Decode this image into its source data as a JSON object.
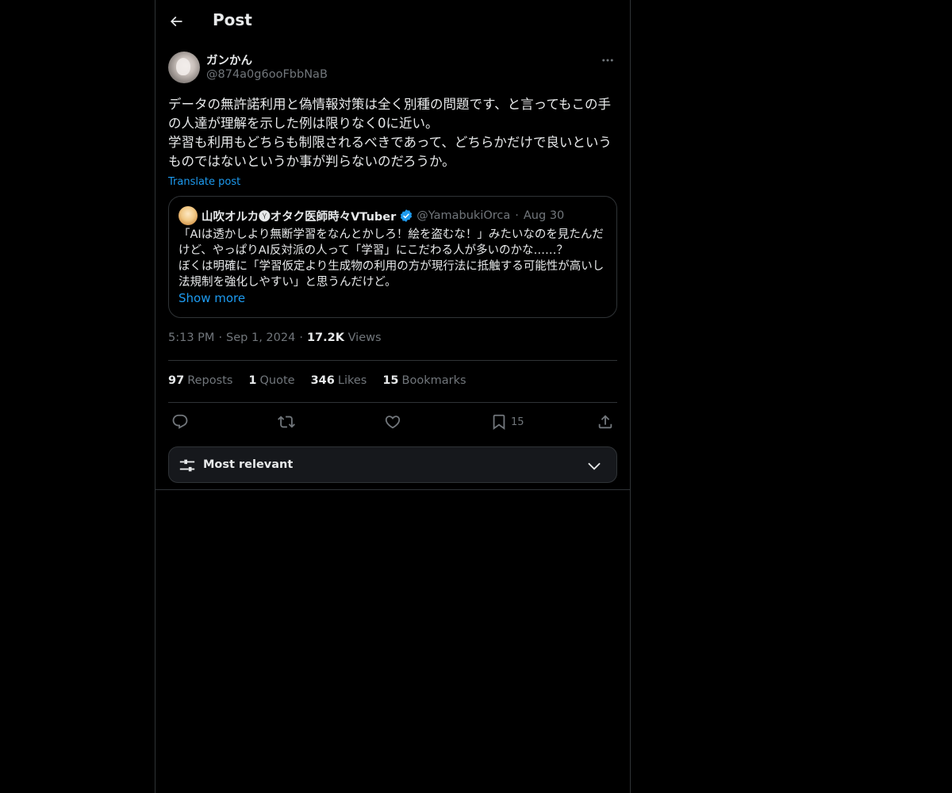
{
  "header": {
    "title": "Post",
    "back_icon": "arrow-left-icon"
  },
  "post": {
    "author_name": "ガンかん",
    "author_handle": "@874a0g6ooFbbNaB",
    "text": "データの無許諾利用と偽情報対策は全く別種の問題です、と言ってもこの手の人達が理解を示した例は限りなく0に近い。\n学習も利用もどちらも制限されるべきであって、どちらかだけで良いというものではないというか事が判らないのだろうか。",
    "translate_label": "Translate post",
    "time": "5:13 PM",
    "date": "Sep 1, 2024",
    "views_count": "17.2K",
    "views_label": "Views"
  },
  "quote": {
    "author_name": "山吹オルカ🅨オタク医師時々VTuber",
    "author_handle": "@YamabukiOrca",
    "date": "Aug 30",
    "text": "「AIは透かしより無断学習をなんとかしろ！絵を盗むな！」みたいなのを見たんだけど、やっぱりAI反対派の人って「学習」にこだわる人が多いのかな……？\nぼくは明確に「学習仮定より生成物の利用の方が現行法に抵触する可能性が高いし法規制を強化しやすい」と思うんだけど。",
    "show_more": "Show more",
    "verified_color": "#1d9bf0"
  },
  "stats": {
    "reposts_count": "97",
    "reposts_label": "Reposts",
    "quotes_count": "1",
    "quotes_label": "Quote",
    "likes_count": "346",
    "likes_label": "Likes",
    "bookmarks_count": "15",
    "bookmarks_label": "Bookmarks"
  },
  "actions": {
    "reply_icon": "reply-icon",
    "repost_icon": "repost-icon",
    "like_icon": "heart-icon",
    "bookmark_icon": "bookmark-icon",
    "bookmark_count": "15",
    "share_icon": "share-icon"
  },
  "sort": {
    "label": "Most relevant"
  },
  "colors": {
    "background": "#000000",
    "accent": "#1d9bf0",
    "muted": "#71767b",
    "border": "#2f3336",
    "text": "#e7e9ea"
  }
}
